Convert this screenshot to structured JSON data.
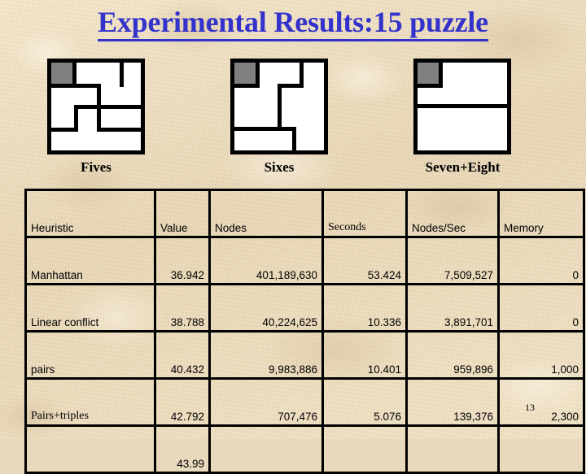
{
  "slide": {
    "title": "Experimental Results:15 puzzle",
    "page_number": "13",
    "background_color": "#ecdcbe",
    "title_color": "#3333cc"
  },
  "figures": [
    {
      "caption": "Fives",
      "blank_tile_color": "#808080",
      "description": "5-tile pattern database partition of the 15 puzzle"
    },
    {
      "caption": "Sixes",
      "blank_tile_color": "#808080",
      "description": "6-tile pattern database partition of the 15 puzzle"
    },
    {
      "caption": "Seven+Eight",
      "blank_tile_color": "#808080",
      "description": "7-8 tile pattern database partition of the 15 puzzle"
    }
  ],
  "table": {
    "headers": {
      "heuristic": "Heuristic",
      "value": "Value",
      "nodes": "Nodes",
      "seconds": "Seconds",
      "nodes_per_sec": "Nodes/Sec",
      "memory": "Memory"
    },
    "rows": [
      {
        "heuristic": "Manhattan",
        "value": "36.942",
        "nodes": "401,189,630",
        "seconds": "53.424",
        "nodes_per_sec": "7,509,527",
        "memory": "0"
      },
      {
        "heuristic": "Linear conflict",
        "value": "38.788",
        "nodes": "40,224,625",
        "seconds": "10.336",
        "nodes_per_sec": "3,891,701",
        "memory": "0"
      },
      {
        "heuristic": "pairs",
        "value": "40.432",
        "nodes": "9,983,886",
        "seconds": "10.401",
        "nodes_per_sec": "959,896",
        "memory": "1,000"
      },
      {
        "heuristic": "Pairs+triples",
        "value": "42.792",
        "nodes": "707,476",
        "seconds": "5.076",
        "nodes_per_sec": "139,376",
        "memory": "2,300"
      },
      {
        "heuristic": "",
        "value": "43.99",
        "nodes": "",
        "seconds": "",
        "nodes_per_sec": "",
        "memory": ""
      }
    ]
  }
}
